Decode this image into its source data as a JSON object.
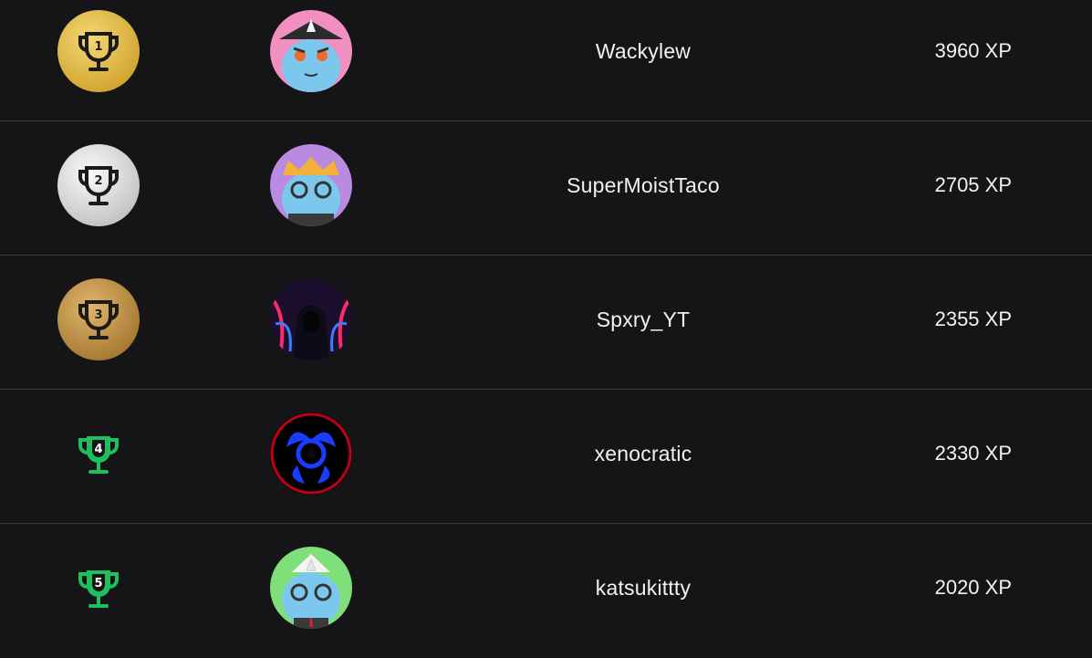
{
  "leaderboard": {
    "rows": [
      {
        "rank": "1",
        "medal": "gold",
        "avatar_icon": "unicorn-pirate-avatar",
        "username": "Wackylew",
        "xp": "3960 XP"
      },
      {
        "rank": "2",
        "medal": "silver",
        "avatar_icon": "unicorn-crown-avatar",
        "username": "SuperMoistTaco",
        "xp": "2705 XP"
      },
      {
        "rank": "3",
        "medal": "bronze",
        "avatar_icon": "neon-hooded-figure-avatar",
        "username": "Spxry_YT",
        "xp": "2355 XP"
      },
      {
        "rank": "4",
        "medal": "none",
        "avatar_icon": "blue-biohazard-avatar",
        "username": "xenocratic",
        "xp": "2330 XP"
      },
      {
        "rank": "5",
        "medal": "none",
        "avatar_icon": "unicorn-sailor-avatar",
        "username": "katsukittty",
        "xp": "2020 XP"
      }
    ]
  },
  "colors": {
    "background": "#151517",
    "divider": "#3a3a3d",
    "trophy_green": "#1fbf5f",
    "gold": "#e2bd4f",
    "silver": "#dcdcdc",
    "bronze": "#c3954c"
  }
}
